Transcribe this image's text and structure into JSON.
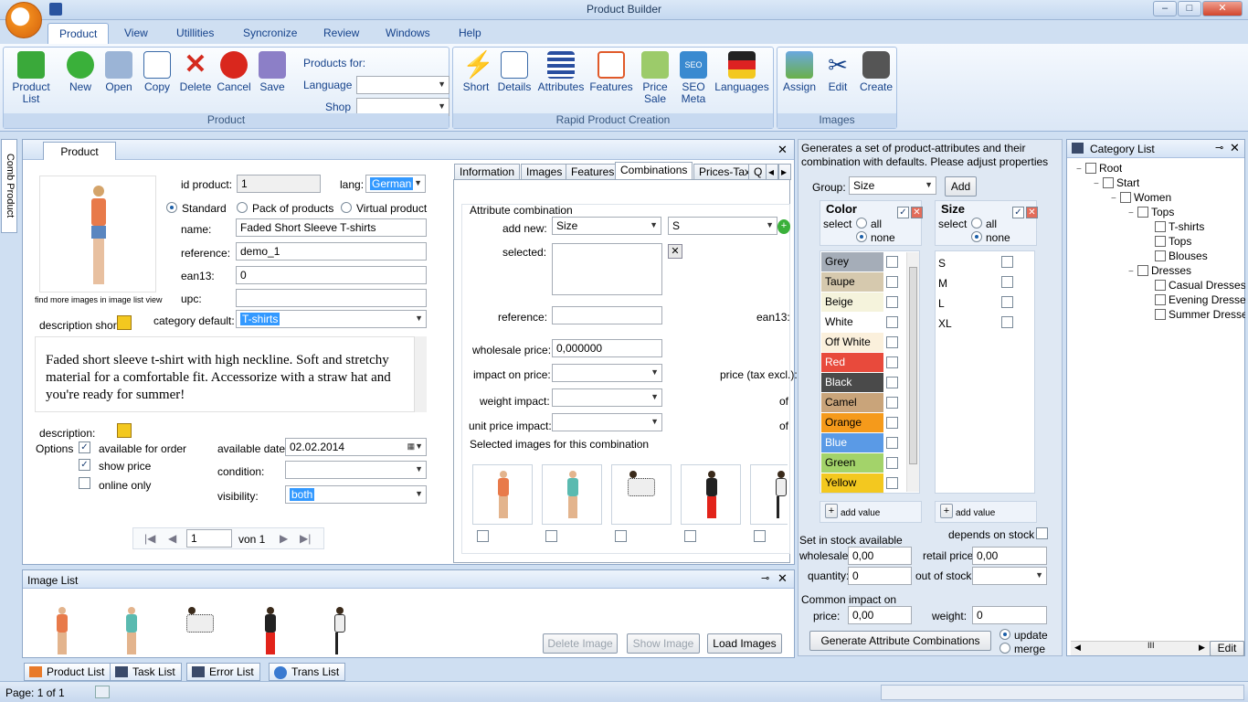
{
  "window": {
    "title": "Product Builder",
    "minimize": "‒",
    "maximize": "□",
    "close": "✕"
  },
  "menu_tabs": [
    "Product",
    "View",
    "Utillities",
    "Syncronize",
    "Review",
    "Windows",
    "Help"
  ],
  "ribbon": {
    "product_group": {
      "title": "Product",
      "buttons": [
        "Product List",
        "New",
        "Open",
        "Copy",
        "Delete",
        "Cancel",
        "Save"
      ],
      "products_for": "Products for:",
      "language_label": "Language",
      "shop_label": "Shop"
    },
    "rapid_group": {
      "title": "Rapid Product Creation",
      "buttons": [
        "Short",
        "Details",
        "Attributes",
        "Features",
        "Price Sale",
        "SEO Meta",
        "Languages"
      ]
    },
    "images_group": {
      "title": "Images",
      "buttons": [
        "Assign",
        "Edit",
        "Create"
      ]
    }
  },
  "side_tab": "Comb Product",
  "product_panel": {
    "tab": "Product",
    "find_more": "find more images in image list view",
    "id_label": "id product:",
    "id_value": "1",
    "lang_label": "lang:",
    "lang_value": "German",
    "type_standard": "Standard",
    "type_pack": "Pack of products",
    "type_virtual": "Virtual product",
    "name_label": "name:",
    "name_value": "Faded Short Sleeve T-shirts",
    "reference_label": "reference:",
    "reference_value": "demo_1",
    "ean13_label": "ean13:",
    "ean13_value": "0",
    "upc_label": "upc:",
    "upc_value": "",
    "desc_short_label": "description short",
    "category_label": "category default:",
    "category_value": "T-shirts",
    "description_text": "Faded short sleeve t-shirt with high neckline. Soft and stretchy material for a comfortable fit. Accessorize with a straw hat and you're ready for summer!",
    "description_label": "description:",
    "options_label": "Options",
    "opt_available": "available for order",
    "opt_show_price": "show price",
    "opt_online": "online only",
    "available_date_label": "available date:",
    "available_date_value": "02.02.2014",
    "condition_label": "condition:",
    "condition_value": "",
    "visibility_label": "visibility:",
    "visibility_value": "both",
    "pager_page": "1",
    "pager_of": "von 1"
  },
  "detail_tabs": [
    "Information",
    "Images",
    "Features",
    "Combinations",
    "Prices-Tax",
    "Q"
  ],
  "combinations": {
    "section": "Attribute combination",
    "add_new_label": "add new:",
    "add_new_group": "Size",
    "add_new_value": "S",
    "selected_label": "selected:",
    "reference_label": "reference:",
    "ean13_label": "ean13:",
    "wholesale_label": "wholesale price:",
    "wholesale_value": "0,000000",
    "impact_price_label": "impact on price:",
    "price_tax_label": "price (tax excl.):",
    "weight_impact_label": "weight impact:",
    "of1": "of",
    "unit_price_label": "unit price impact:",
    "of2": "of",
    "selected_images_label": "Selected images for this combination"
  },
  "generator": {
    "description": "Generates a set of product-attributes and their combination with defaults. Please adjust properties in products",
    "group_label": "Group:",
    "group_value": "Size",
    "add_button": "Add",
    "color_title": "Color",
    "size_title": "Size",
    "select_label": "select",
    "all": "all",
    "none": "none",
    "colors": [
      {
        "name": "Grey",
        "hex": "#a5adb8"
      },
      {
        "name": "Taupe",
        "hex": "#d6c9ae"
      },
      {
        "name": "Beige",
        "hex": "#f5f3dc"
      },
      {
        "name": "White",
        "hex": "#ffffff"
      },
      {
        "name": "Off White",
        "hex": "#fbf0dc"
      },
      {
        "name": "Red",
        "hex": "#e84a3c"
      },
      {
        "name": "Black",
        "hex": "#4a4a4a"
      },
      {
        "name": "Camel",
        "hex": "#c9a47a"
      },
      {
        "name": "Orange",
        "hex": "#f59a1b"
      },
      {
        "name": "Blue",
        "hex": "#5a9ae6"
      },
      {
        "name": "Green",
        "hex": "#a3d36a"
      },
      {
        "name": "Yellow",
        "hex": "#f3c81f"
      }
    ],
    "sizes": [
      "S",
      "M",
      "L",
      "XL"
    ],
    "add_value": "add value",
    "stock_available": "Set in stock available",
    "depends_on_stock": "depends on stock",
    "wholesale_label": "wholesale:",
    "wholesale_value": "0,00",
    "retail_label": "retail price",
    "retail_value": "0,00",
    "quantity_label": "quantity:",
    "quantity_value": "0",
    "out_of_stock_label": "out of stock:",
    "common_impact": "Common impact on",
    "price_label": "price:",
    "price_value": "0,00",
    "weight_label": "weight:",
    "weight_value": "0",
    "generate_button": "Generate Attribute Combinations",
    "update": "update",
    "merge": "merge"
  },
  "category_list": {
    "title": "Category List",
    "tree": [
      {
        "label": "Root",
        "level": 0,
        "exp": "−"
      },
      {
        "label": "Start",
        "level": 1,
        "exp": "−"
      },
      {
        "label": "Women",
        "level": 2,
        "exp": "−"
      },
      {
        "label": "Tops",
        "level": 3,
        "exp": "−"
      },
      {
        "label": "T-shirts",
        "level": 4,
        "exp": ""
      },
      {
        "label": "Tops",
        "level": 4,
        "exp": ""
      },
      {
        "label": "Blouses",
        "level": 4,
        "exp": ""
      },
      {
        "label": "Dresses",
        "level": 3,
        "exp": "−"
      },
      {
        "label": "Casual Dresses",
        "level": 4,
        "exp": ""
      },
      {
        "label": "Evening Dresses",
        "level": 4,
        "exp": ""
      },
      {
        "label": "Summer Dresses",
        "level": 4,
        "exp": ""
      }
    ],
    "scroll_label": "III",
    "edit_button": "Edit"
  },
  "image_list": {
    "title": "Image List",
    "delete": "Delete Image",
    "show": "Show Image",
    "load": "Load Images"
  },
  "bottom_tabs": [
    "Product List",
    "Task List",
    "Error List",
    "Trans List"
  ],
  "status": {
    "page": "Page: 1 of 1"
  },
  "colors": {
    "accent": "#15428b",
    "ribbon_bg": "#dbe7f6",
    "selection": "#3399ff"
  }
}
